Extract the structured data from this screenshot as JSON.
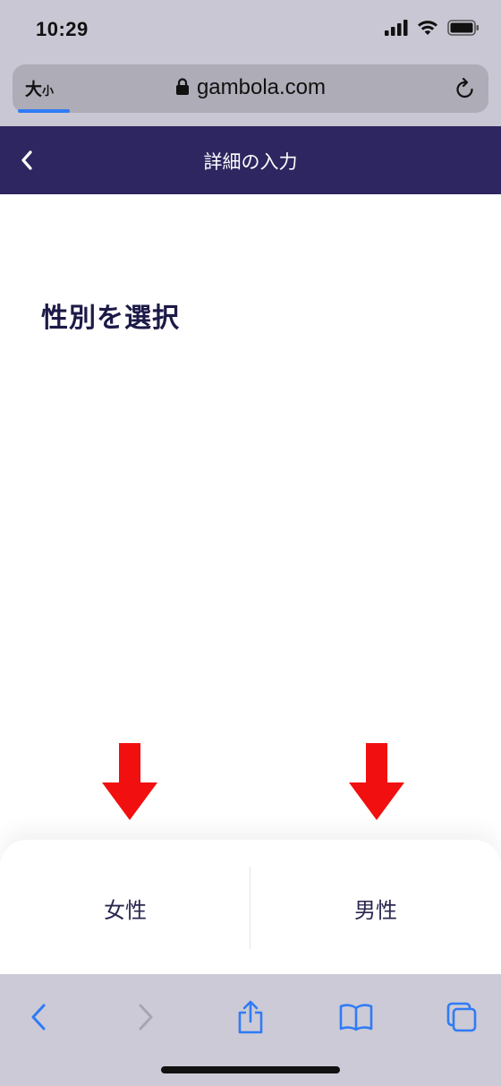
{
  "status_bar": {
    "time": "10:29",
    "icons": [
      "cellular-signal-icon",
      "wifi-icon",
      "battery-icon"
    ]
  },
  "browser": {
    "text_size_big": "大",
    "text_size_small": "小",
    "domain": "gambola.com",
    "lock_icon": "lock-icon",
    "reload_icon": "reload-icon",
    "accent_color": "#2f7bf6"
  },
  "header": {
    "title": "詳細の入力",
    "back_icon": "chevron-left-icon",
    "background": "#2d2660"
  },
  "main": {
    "heading": "性別を選択"
  },
  "annotations": {
    "arrow_color": "#f20f0f",
    "arrows": [
      "down-arrow-icon",
      "down-arrow-icon"
    ]
  },
  "gender_options": [
    {
      "label": "女性"
    },
    {
      "label": "男性"
    }
  ],
  "toolbar": {
    "icons": [
      "back-icon",
      "forward-icon",
      "share-icon",
      "bookmarks-icon",
      "tabs-icon"
    ]
  }
}
